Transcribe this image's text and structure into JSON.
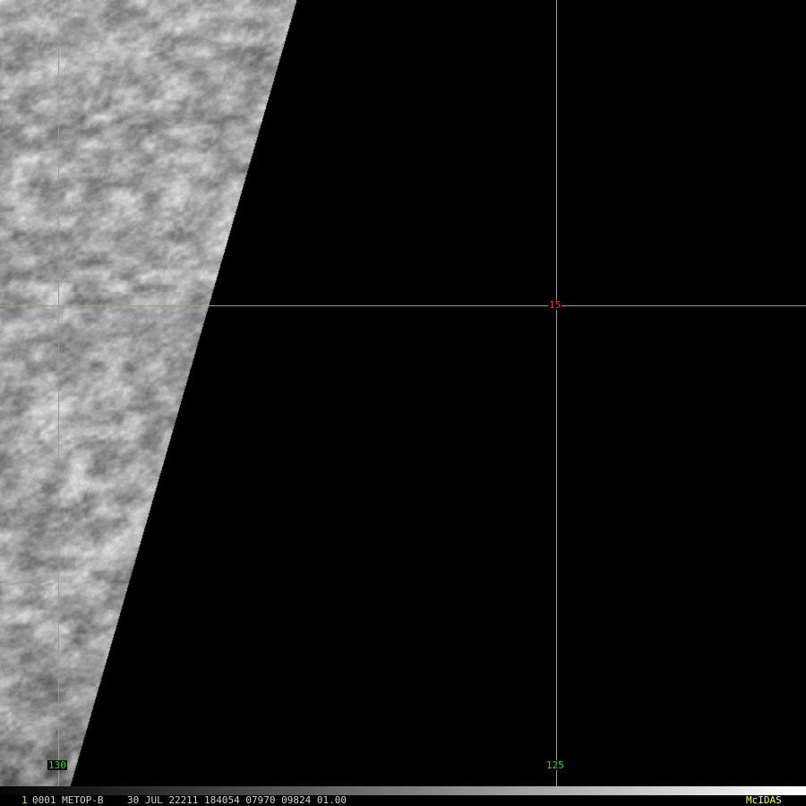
{
  "colors": {
    "background": "#000000",
    "grid": "#35c6c6",
    "lon_label": "#22dd22",
    "lat_label": "#ff2a2a",
    "status_text": "#d6d6d6",
    "frame_number": "#ffd800",
    "brand": "#ffff33"
  },
  "map": {
    "longitudes": [
      {
        "value": 130,
        "label": "130"
      },
      {
        "value": 125,
        "label": "125"
      }
    ],
    "latitudes": [
      {
        "value": 15,
        "label": "15"
      }
    ]
  },
  "status": {
    "frame_number": "1",
    "line": "0001 METOP-B    30 JUL 22211 184054 07970 09824 01.00",
    "brand": "McIDAS"
  }
}
